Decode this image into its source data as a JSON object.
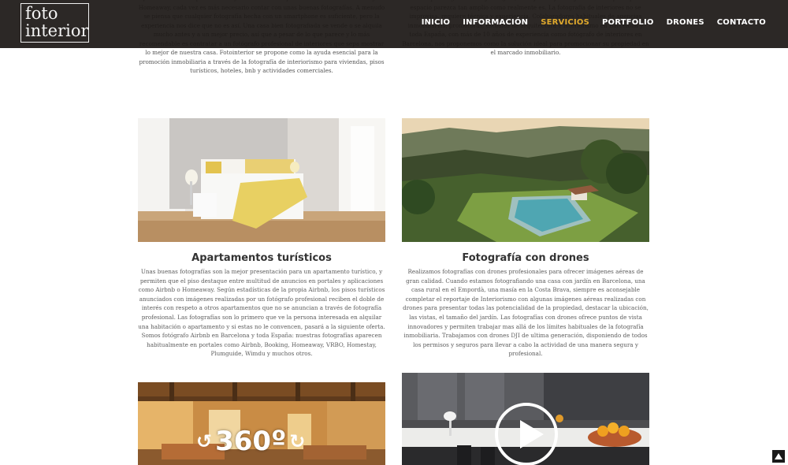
{
  "logo": {
    "line1": "foto",
    "line2": "interior"
  },
  "nav": [
    {
      "label": "INICIO",
      "active": false
    },
    {
      "label": "INFORMACIÓN",
      "active": false
    },
    {
      "label": "SERVICIOS",
      "active": true
    },
    {
      "label": "PORTFOLIO",
      "active": false
    },
    {
      "label": "DRONES",
      "active": false
    },
    {
      "label": "CONTACTO",
      "active": false
    }
  ],
  "intro": {
    "left": "La fotografía de interiores es una especialidad que está cada vez más presente en internet gracias a la aparición de portales dedicados a la venta inmobiliaria y al alquiler de apartamentos turísticos. Desde personas que quieren vender su casa a través de plataformas como Fotocasa, Idealista o Habitaclia a hoteles que quieren promocionar sus apartamentos y habitaciones en portales como Airbnb. Booking o Homeaway, cada vez es más necesario contar con unas buenas fotografías. A menudo se piensa que cualquier fotografía hecha con un smartphone es suficiente, pero la experiencia nos dice que no es así. Una casa bien fotografiada se vende o se alquila mucho antes y a un mejor precio, así que a pesar de lo que parece y lo más recomendable es contratar a un fotógrafo profesional de interiores que sepa mostrar lo mejor de nuestra casa. Fotointerior se propone como la ayuda esencial para la promoción inmobiliaria a través de la fotografía de interiorismo para viviendas, pisos turísticos, hoteles, bnb y actividades comerciales.",
    "right": "En los portales de internet como Fotocasa, Idealista, Habitaclia y Houzz las fotografías presentan la casa al mundo y unas imágenes mal hechas o de poca calidad pueden ser la causa de que un comprador potencial no se interese por una vivienda. Las fotografías son el primer contacto que tiene un cliente con la casa, por eso siempre elegimos el mejor ángulo, la mejor luz y el mejor encuadre para que el espacio parezca tan amplio como realmente es. La fotografía de interiores no se improvisa, requiere técnica y experiencia. Colaboradores habituales de agencias inmobiliarias, promotoras, estudios de arquitectura e interiorismo en Barcelona y toda España, con más de 10 años de experiencia como fotógrafo de interiores en Barcelona, nos proponemos como la solución ideal para promocionar su propiedad en el marcado inmobiliario."
  },
  "cards": [
    {
      "title": "Apartamentos turísticos",
      "text": "Unas buenas fotografías son la mejor presentación para un apartamento turístico, y permiten que el piso destaque entre multitud de anuncios en portales y aplicaciones como Airbnb o Homeaway. Según estadísticas de la propia Airbnb, los pisos turísticos anunciados con imágenes realizadas por un fotógrafo profesional reciben el doble de interés con respeto a otros apartamentos que no se anuncian a través de fotografía profesional. Las fotografías son lo primero que ve la persona interesada en alquilar una habitación o apartamento y si estas no le convencen, pasará a la siguiente oferta. Somos fotógrafo Airbnb en Barcelona y toda España: nuestras fotografías aparecen habitualmente en portales como Airbnb, Booking, Homeaway, VRBO, Homestay, Plumguide, Wimdu y muchos otros."
    },
    {
      "title": "Fotografía con drones",
      "text": "Realizamos fotografías con drones profesionales para ofrecer imágenes aéreas de gran calidad. Cuando estamos fotografiando una casa con jardín en Barcelona, una casa rural en el Empordà, una masía en la Costa Brava, siempre es aconsejable completar el reportaje de Interiorismo con algunas imágenes aéreas realizadas con drones para presentar todas las potencialidad de la propiedad, destacar la ubicación, las vistas, el tamaño del jardín. Las fotografías con drones ofrece puntos de vista innovadores y permiten trabajar mas allá de los límites habituales de la fotografía inmobiliaria. Trabajamos con drones DJI de ultima generación, disponiendo de todos los permisos y seguros para llevar a cabo la actividad de una manera segura y profesional."
    }
  ],
  "overlay360": "360º"
}
